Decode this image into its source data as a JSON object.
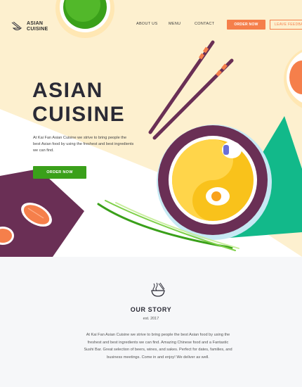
{
  "brand": {
    "name_line1": "ASIAN",
    "name_line2": "CUISINE"
  },
  "nav": {
    "about": "ABOUT US",
    "menu": "MENU",
    "contact": "CONTACT"
  },
  "header_buttons": {
    "order": "ORDER NOW",
    "feedback": "LEAVE FEEDBACK"
  },
  "hero": {
    "title_line1": "ASIAN",
    "title_line2": "CUISINE",
    "description": "At Kai Fan Asian Cuisine we strive to bring people the best Asian food by using the freshest and best ingredients we can find.",
    "cta": "ORDER NOW"
  },
  "story": {
    "title": "OUR STORY",
    "est": "est. 2017",
    "text": "At Kai Fan Asian Cuisine we strive to bring people the best Asian food by using the freshest and best ingredients we can find. Amazing Chinese food and a Fantastic Sushi Bar. Great selection of beers, wines, and sakes. Perfect for dates, families, and business meetings. Come in and enjoy! We deliver as well."
  },
  "icons": {
    "logo": "chopsticks-bowl-icon",
    "story": "noodle-bowl-icon"
  },
  "colors": {
    "hero_bg": "#fdf0cf",
    "accent_orange": "#f57f4b",
    "accent_green": "#3aa01a",
    "bowl_purple": "#6a2f55",
    "teal": "#12b98a",
    "yolk": "#f9c21b",
    "dark_text": "#2a2a35"
  }
}
